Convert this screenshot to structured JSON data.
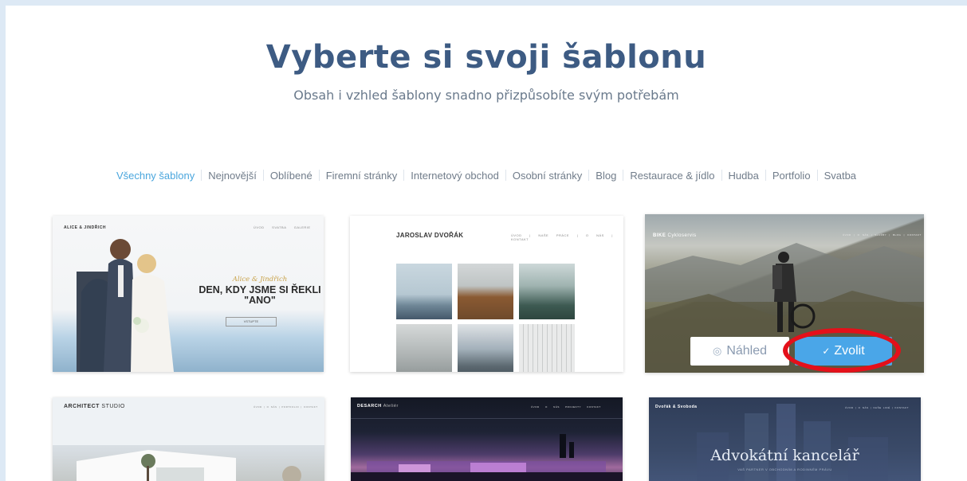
{
  "header": {
    "title": "Vyberte si svoji šablonu",
    "subtitle": "Obsah i vzhled šablony snadno přizpůsobíte svým potřebám"
  },
  "filters": [
    {
      "label": "Všechny šablony",
      "active": true
    },
    {
      "label": "Nejnovější"
    },
    {
      "label": "Oblíbené"
    },
    {
      "label": "Firemní stránky"
    },
    {
      "label": "Internetový obchod"
    },
    {
      "label": "Osobní stránky"
    },
    {
      "label": "Blog"
    },
    {
      "label": "Restaurace & jídlo"
    },
    {
      "label": "Hudba"
    },
    {
      "label": "Portfolio"
    },
    {
      "label": "Svatba"
    }
  ],
  "templates": {
    "wedding": {
      "logo": "ALICE & JINDŘICH",
      "nav": "ÚVOD SVATBA GALERIE",
      "script": "Alice & Jindřich",
      "title_line1": "DEN, KDY JSME SI ŘEKLI",
      "title_line2": "\"ANO\"",
      "button": "VSTUPTE"
    },
    "portfolio": {
      "name": "JAROSLAV DVOŘÁK",
      "nav": "ÚVOD | NAŠE PRÁCE | O NÁS | KONTAKT"
    },
    "bike": {
      "logo_bold": "BIKE",
      "logo_rest": "Cykloservis",
      "nav": "ÚVOD | O NÁS | SLUŽBY | BLOG | KONTAKT",
      "preview_label": "Náhled",
      "select_label": "Zvolit",
      "preview_icon": "eye-icon",
      "select_icon": "check-icon"
    },
    "architect": {
      "logo_bold": "ARCHITECT",
      "logo_rest": "STUDIO",
      "nav": "ÚVOD | O NÁS | PORTFOLIO | KONTAKT"
    },
    "desarch": {
      "logo_bold": "DESARCH",
      "logo_rest": "Ateliér",
      "nav": "ÚVOD O NÁS PROJEKTY KONTAKT"
    },
    "law": {
      "logo": "Dvořák & Svoboda",
      "nav": "ÚVOD | O NÁS | NAŠE LIDÉ | KONTAKT",
      "title": "Advokátní kancelář",
      "sub": "VAŠ PARTNER V OBCHODNÍM A RODINNÉM PRÁVU"
    }
  },
  "colors": {
    "accent": "#4aa6e8",
    "heading": "#3d5b83",
    "highlight": "#e4101a"
  }
}
